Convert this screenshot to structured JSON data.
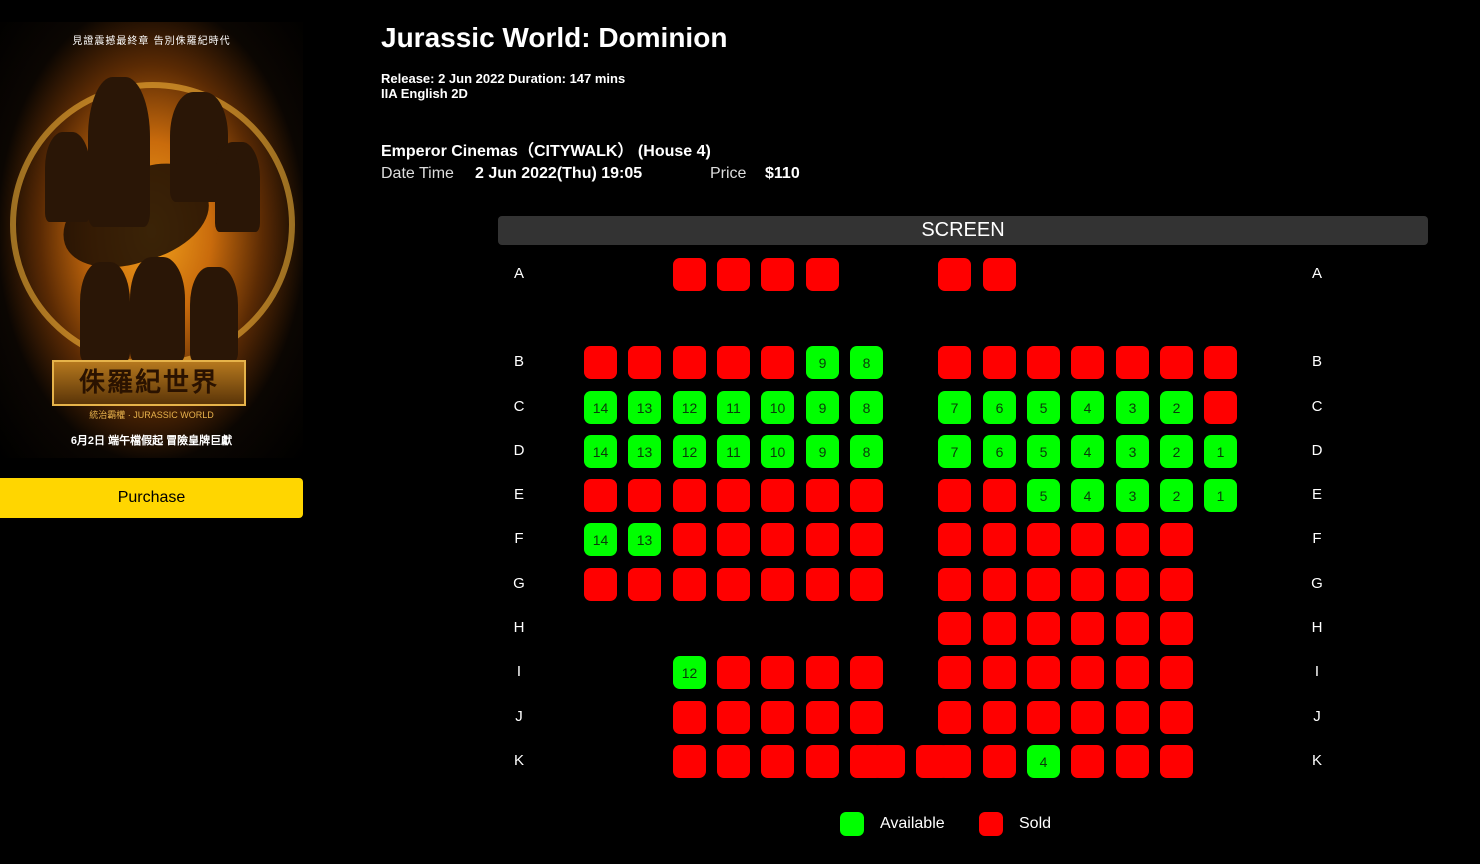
{
  "poster": {
    "tagline": "見證震撼最終章 告別侏羅紀時代",
    "title_zh": "侏羅紀世界",
    "subtitle_zh": "統治霸權",
    "logo_en": "JURASSIC WORLD",
    "release_line": "6月2日 端午檔假起 冒險皇牌巨獻"
  },
  "purchase_label": "Purchase",
  "movie": {
    "title": "Jurassic World: Dominion",
    "release_line": "Release: 2 Jun 2022 Duration: 147 mins",
    "format_line": "IIA English 2D",
    "cinema": "Emperor Cinemas（CITYWALK） (House 4)",
    "datetime_label": "Date Time",
    "datetime_value": "2 Jun 2022(Thu) 19:05",
    "price_label": "Price",
    "price_value": "$110"
  },
  "screen_label": "SCREEN",
  "colors": {
    "available": "#00ff00",
    "sold": "#ff0000",
    "purchase": "#ffd600"
  },
  "seat_rows": [
    {
      "row": "A",
      "seats": [
        {
          "col": 3,
          "status": "sold"
        },
        {
          "col": 4,
          "status": "sold"
        },
        {
          "col": 5,
          "status": "sold"
        },
        {
          "col": 6,
          "status": "sold"
        },
        {
          "col": 9,
          "status": "sold"
        },
        {
          "col": 10,
          "status": "sold"
        }
      ]
    },
    {
      "row": "B",
      "seats": [
        {
          "col": 1,
          "status": "sold"
        },
        {
          "col": 2,
          "status": "sold"
        },
        {
          "col": 3,
          "status": "sold"
        },
        {
          "col": 4,
          "status": "sold"
        },
        {
          "col": 5,
          "status": "sold"
        },
        {
          "col": 6,
          "status": "available",
          "num": "9"
        },
        {
          "col": 7,
          "status": "available",
          "num": "8"
        },
        {
          "col": 9,
          "status": "sold"
        },
        {
          "col": 10,
          "status": "sold"
        },
        {
          "col": 11,
          "status": "sold"
        },
        {
          "col": 12,
          "status": "sold"
        },
        {
          "col": 13,
          "status": "sold"
        },
        {
          "col": 14,
          "status": "sold"
        },
        {
          "col": 15,
          "status": "sold"
        }
      ]
    },
    {
      "row": "C",
      "seats": [
        {
          "col": 1,
          "status": "available",
          "num": "14"
        },
        {
          "col": 2,
          "status": "available",
          "num": "13"
        },
        {
          "col": 3,
          "status": "available",
          "num": "12"
        },
        {
          "col": 4,
          "status": "available",
          "num": "11"
        },
        {
          "col": 5,
          "status": "available",
          "num": "10"
        },
        {
          "col": 6,
          "status": "available",
          "num": "9"
        },
        {
          "col": 7,
          "status": "available",
          "num": "8"
        },
        {
          "col": 9,
          "status": "available",
          "num": "7"
        },
        {
          "col": 10,
          "status": "available",
          "num": "6"
        },
        {
          "col": 11,
          "status": "available",
          "num": "5"
        },
        {
          "col": 12,
          "status": "available",
          "num": "4"
        },
        {
          "col": 13,
          "status": "available",
          "num": "3"
        },
        {
          "col": 14,
          "status": "available",
          "num": "2"
        },
        {
          "col": 15,
          "status": "sold"
        }
      ]
    },
    {
      "row": "D",
      "seats": [
        {
          "col": 1,
          "status": "available",
          "num": "14"
        },
        {
          "col": 2,
          "status": "available",
          "num": "13"
        },
        {
          "col": 3,
          "status": "available",
          "num": "12"
        },
        {
          "col": 4,
          "status": "available",
          "num": "11"
        },
        {
          "col": 5,
          "status": "available",
          "num": "10"
        },
        {
          "col": 6,
          "status": "available",
          "num": "9"
        },
        {
          "col": 7,
          "status": "available",
          "num": "8"
        },
        {
          "col": 9,
          "status": "available",
          "num": "7"
        },
        {
          "col": 10,
          "status": "available",
          "num": "6"
        },
        {
          "col": 11,
          "status": "available",
          "num": "5"
        },
        {
          "col": 12,
          "status": "available",
          "num": "4"
        },
        {
          "col": 13,
          "status": "available",
          "num": "3"
        },
        {
          "col": 14,
          "status": "available",
          "num": "2"
        },
        {
          "col": 15,
          "status": "available",
          "num": "1"
        }
      ]
    },
    {
      "row": "E",
      "seats": [
        {
          "col": 1,
          "status": "sold"
        },
        {
          "col": 2,
          "status": "sold"
        },
        {
          "col": 3,
          "status": "sold"
        },
        {
          "col": 4,
          "status": "sold"
        },
        {
          "col": 5,
          "status": "sold"
        },
        {
          "col": 6,
          "status": "sold"
        },
        {
          "col": 7,
          "status": "sold"
        },
        {
          "col": 9,
          "status": "sold"
        },
        {
          "col": 10,
          "status": "sold"
        },
        {
          "col": 11,
          "status": "available",
          "num": "5"
        },
        {
          "col": 12,
          "status": "available",
          "num": "4"
        },
        {
          "col": 13,
          "status": "available",
          "num": "3"
        },
        {
          "col": 14,
          "status": "available",
          "num": "2"
        },
        {
          "col": 15,
          "status": "available",
          "num": "1"
        }
      ]
    },
    {
      "row": "F",
      "seats": [
        {
          "col": 1,
          "status": "available",
          "num": "14"
        },
        {
          "col": 2,
          "status": "available",
          "num": "13"
        },
        {
          "col": 3,
          "status": "sold"
        },
        {
          "col": 4,
          "status": "sold"
        },
        {
          "col": 5,
          "status": "sold"
        },
        {
          "col": 6,
          "status": "sold"
        },
        {
          "col": 7,
          "status": "sold"
        },
        {
          "col": 9,
          "status": "sold"
        },
        {
          "col": 10,
          "status": "sold"
        },
        {
          "col": 11,
          "status": "sold"
        },
        {
          "col": 12,
          "status": "sold"
        },
        {
          "col": 13,
          "status": "sold"
        },
        {
          "col": 14,
          "status": "sold"
        }
      ]
    },
    {
      "row": "G",
      "seats": [
        {
          "col": 1,
          "status": "sold"
        },
        {
          "col": 2,
          "status": "sold"
        },
        {
          "col": 3,
          "status": "sold"
        },
        {
          "col": 4,
          "status": "sold"
        },
        {
          "col": 5,
          "status": "sold"
        },
        {
          "col": 6,
          "status": "sold"
        },
        {
          "col": 7,
          "status": "sold"
        },
        {
          "col": 9,
          "status": "sold"
        },
        {
          "col": 10,
          "status": "sold"
        },
        {
          "col": 11,
          "status": "sold"
        },
        {
          "col": 12,
          "status": "sold"
        },
        {
          "col": 13,
          "status": "sold"
        },
        {
          "col": 14,
          "status": "sold"
        }
      ]
    },
    {
      "row": "H",
      "seats": [
        {
          "col": 9,
          "status": "sold"
        },
        {
          "col": 10,
          "status": "sold"
        },
        {
          "col": 11,
          "status": "sold"
        },
        {
          "col": 12,
          "status": "sold"
        },
        {
          "col": 13,
          "status": "sold"
        },
        {
          "col": 14,
          "status": "sold"
        }
      ]
    },
    {
      "row": "I",
      "seats": [
        {
          "col": 3,
          "status": "available",
          "num": "12"
        },
        {
          "col": 4,
          "status": "sold"
        },
        {
          "col": 5,
          "status": "sold"
        },
        {
          "col": 6,
          "status": "sold"
        },
        {
          "col": 7,
          "status": "sold"
        },
        {
          "col": 9,
          "status": "sold"
        },
        {
          "col": 10,
          "status": "sold"
        },
        {
          "col": 11,
          "status": "sold"
        },
        {
          "col": 12,
          "status": "sold"
        },
        {
          "col": 13,
          "status": "sold"
        },
        {
          "col": 14,
          "status": "sold"
        }
      ]
    },
    {
      "row": "J",
      "seats": [
        {
          "col": 3,
          "status": "sold"
        },
        {
          "col": 4,
          "status": "sold"
        },
        {
          "col": 5,
          "status": "sold"
        },
        {
          "col": 6,
          "status": "sold"
        },
        {
          "col": 7,
          "status": "sold"
        },
        {
          "col": 9,
          "status": "sold"
        },
        {
          "col": 10,
          "status": "sold"
        },
        {
          "col": 11,
          "status": "sold"
        },
        {
          "col": 12,
          "status": "sold"
        },
        {
          "col": 13,
          "status": "sold"
        },
        {
          "col": 14,
          "status": "sold"
        }
      ]
    },
    {
      "row": "K",
      "seats": [
        {
          "col": 3,
          "status": "sold"
        },
        {
          "col": 4,
          "status": "sold"
        },
        {
          "col": 5,
          "status": "sold"
        },
        {
          "col": 6,
          "status": "sold"
        },
        {
          "col": 7,
          "status": "sold"
        },
        {
          "col": 7.5,
          "status": "sold"
        },
        {
          "col": 8.5,
          "status": "sold"
        },
        {
          "col": 9,
          "status": "sold"
        },
        {
          "col": 10,
          "status": "sold"
        },
        {
          "col": 11,
          "status": "available",
          "num": "4"
        },
        {
          "col": 12,
          "status": "sold"
        },
        {
          "col": 13,
          "status": "sold"
        },
        {
          "col": 14,
          "status": "sold"
        }
      ]
    }
  ],
  "legend": {
    "available": "Available",
    "sold": "Sold"
  }
}
